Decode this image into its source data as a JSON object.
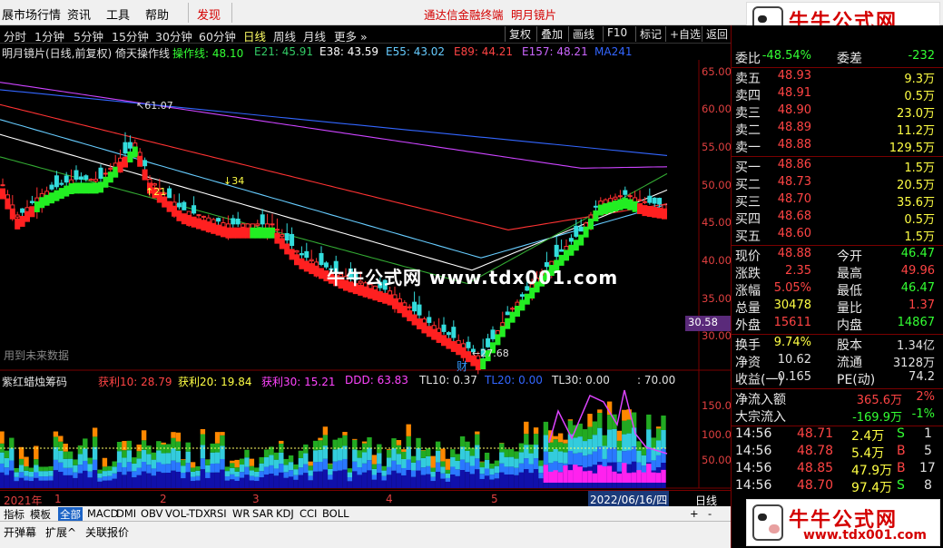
{
  "menu": {
    "items": [
      "展市场行情",
      "资讯",
      "工具",
      "帮助"
    ],
    "discover": "发现",
    "center_title": "通达信金融终端",
    "center_subtitle": "明月镜片"
  },
  "logo": {
    "text": "牛牛公式网",
    "url": "www.tdx001.com"
  },
  "periods": [
    "分时",
    "1分钟",
    "5分钟",
    "15分钟",
    "30分钟",
    "60分钟",
    "日线",
    "周线",
    "月线",
    "更多 »"
  ],
  "active_period": "日线",
  "toolbar": [
    "复权",
    "叠加",
    "画线",
    "F10",
    "标记",
    "+自选",
    "返回"
  ],
  "chart_title": {
    "name": "明月镜片(日线,前复权)",
    "indicator": "倚天操作线",
    "series": [
      {
        "label": "操作线: 48.10",
        "color": "#33ff33"
      },
      {
        "label": "E21: 45.91",
        "color": "#33cc66"
      },
      {
        "label": "E38: 43.59",
        "color": "#ffffff"
      },
      {
        "label": "E55: 43.02",
        "color": "#66ccff"
      },
      {
        "label": "E89: 44.21",
        "color": "#ff4444"
      },
      {
        "label": "E157: 48.21",
        "color": "#cc66ff"
      },
      {
        "label": "MA241",
        "color": "#3366ff"
      }
    ]
  },
  "price_axis": [
    "65.00",
    "60.00",
    "55.00",
    "50.00",
    "45.00",
    "40.00",
    "35.00",
    "30.00"
  ],
  "price_marker": "30.58",
  "annotations": {
    "high": "61.07",
    "low": "27.68",
    "up21": "↑21",
    "down34": "↓34",
    "up21b": "↑21",
    "future_data": "用到未来数据",
    "cai": "财"
  },
  "watermark": "牛牛公式网 www.tdx001.com",
  "sub_chart": {
    "name": "紫红蜡烛筹码",
    "series": [
      {
        "label": "获利10: 28.79",
        "color": "#ff4444"
      },
      {
        "label": "获利20: 19.84",
        "color": "#ffff44"
      },
      {
        "label": "获利30: 15.21",
        "color": "#ff44ff"
      },
      {
        "label": "DDD: 63.83",
        "color": "#ff44ff"
      },
      {
        "label": "TL10: 0.37",
        "color": "#e0e0e0"
      },
      {
        "label": "TL20: 0.00",
        "color": "#3366ff"
      },
      {
        "label": "TL30: 0.00",
        "color": "#e0e0e0"
      },
      {
        "label": ": 70.00",
        "color": "#e0e0e0"
      }
    ],
    "axis": [
      "150.00",
      "100.00",
      "50.00"
    ]
  },
  "time_axis": {
    "year": "2021年",
    "months": [
      "1",
      "2",
      "3",
      "4",
      "5"
    ],
    "cursor_date": "2022/06/16/四",
    "right_label": "日线"
  },
  "index_tabs": [
    "指标",
    "模板",
    "全部",
    "MACD",
    "DMI",
    "OBV",
    "VOL-TDX",
    "RSI",
    "WR",
    "SAR",
    "KDJ",
    "CCI",
    "BOLL"
  ],
  "active_index_tab": "全部",
  "bottom_tabs": [
    "开弹幕",
    "扩展^",
    "关联报价"
  ],
  "quote": {
    "weibi": {
      "label": "委比",
      "value": "-48.54%",
      "label2": "委差",
      "value2": "-232"
    },
    "asks": [
      {
        "label": "卖五",
        "price": "48.93",
        "vol": "9.3万"
      },
      {
        "label": "卖四",
        "price": "48.91",
        "vol": "0.5万"
      },
      {
        "label": "卖三",
        "price": "48.90",
        "vol": "23.0万"
      },
      {
        "label": "卖二",
        "price": "48.89",
        "vol": "11.2万"
      },
      {
        "label": "卖一",
        "price": "48.88",
        "vol": "129.5万"
      }
    ],
    "bids": [
      {
        "label": "买一",
        "price": "48.86",
        "vol": "1.5万"
      },
      {
        "label": "买二",
        "price": "48.73",
        "vol": "20.5万"
      },
      {
        "label": "买三",
        "price": "48.70",
        "vol": "35.6万"
      },
      {
        "label": "买四",
        "price": "48.68",
        "vol": "0.5万"
      },
      {
        "label": "买五",
        "price": "48.60",
        "vol": "1.5万"
      }
    ],
    "stats": [
      {
        "l1": "现价",
        "v1": "48.88",
        "c1": "#ff4444",
        "l2": "今开",
        "v2": "46.47",
        "c2": "#33ff33"
      },
      {
        "l1": "涨跌",
        "v1": "2.35",
        "c1": "#ff4444",
        "l2": "最高",
        "v2": "49.96",
        "c2": "#ff4444"
      },
      {
        "l1": "涨幅",
        "v1": "5.05%",
        "c1": "#ff4444",
        "l2": "最低",
        "v2": "46.47",
        "c2": "#33ff33"
      },
      {
        "l1": "总量",
        "v1": "30478",
        "c1": "#ffff44",
        "l2": "量比",
        "v2": "1.37",
        "c2": "#ff4444"
      },
      {
        "l1": "外盘",
        "v1": "15611",
        "c1": "#ff4444",
        "l2": "内盘",
        "v2": "14867",
        "c2": "#33ff33"
      }
    ],
    "stats2": [
      {
        "l1": "换手",
        "v1": "9.74%",
        "l2": "股本",
        "v2": "1.34亿"
      },
      {
        "l1": "净资",
        "v1": "10.62",
        "l2": "流通",
        "v2": "3128万"
      },
      {
        "l1": "收益(一)",
        "v1": "0.165",
        "l2": "PE(动)",
        "v2": "74.2"
      }
    ],
    "flows": [
      {
        "label": "净流入额",
        "value": "365.6万",
        "pct": "2%",
        "color": "#ff4444"
      },
      {
        "label": "大宗流入",
        "value": "-169.9万",
        "pct": "-1%",
        "color": "#33ff33"
      }
    ],
    "ticks": [
      {
        "time": "14:56",
        "price": "48.71",
        "vol": "2.4万",
        "bs": "S",
        "n": "1"
      },
      {
        "time": "14:56",
        "price": "48.78",
        "vol": "5.4万",
        "bs": "B",
        "n": "5"
      },
      {
        "time": "14:56",
        "price": "48.85",
        "vol": "47.9万",
        "bs": "B",
        "n": "17"
      },
      {
        "time": "14:56",
        "price": "48.70",
        "vol": "97.4万",
        "bs": "S",
        "n": "8"
      }
    ]
  }
}
